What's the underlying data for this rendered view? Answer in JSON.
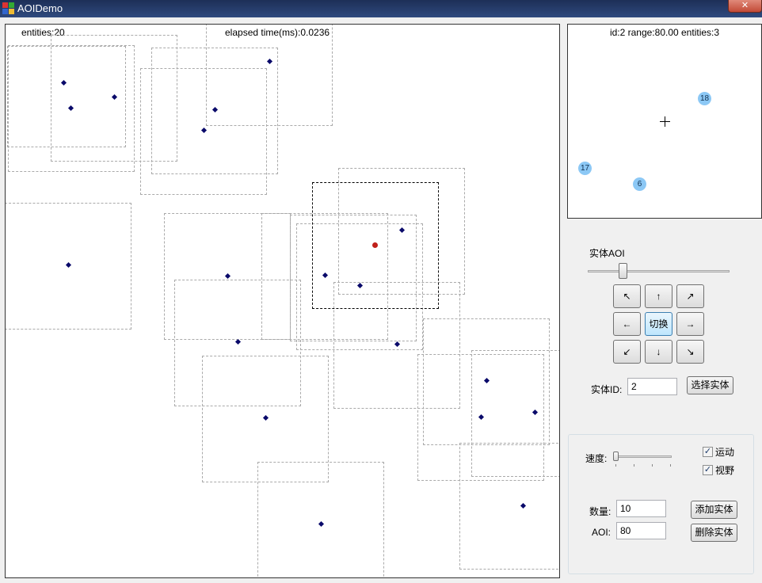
{
  "window": {
    "title": "AOIDemo",
    "close_glyph": "✕"
  },
  "world": {
    "entities_text": "entities:20",
    "elapsed_text": "elapsed time(ms):0.0236"
  },
  "minimap": {
    "info": "id:2 range:80.00 entities:3",
    "neighbors": [
      "18",
      "17",
      "6"
    ]
  },
  "controls": {
    "entity_aoi_label": "实体AOI",
    "directions": {
      "up_left": "↖",
      "up": "↑",
      "up_right": "↗",
      "left": "←",
      "toggle": "切换",
      "right": "→",
      "down_left": "↙",
      "down": "↓",
      "down_right": "↘"
    },
    "entity_id_label": "实体ID:",
    "entity_id_value": "2",
    "select_entity_button": "选择实体",
    "speed_label": "速度:",
    "move_checkbox": {
      "label": "运动",
      "checked": true
    },
    "view_checkbox": {
      "label": "视野",
      "checked": true
    },
    "count_label": "数量:",
    "count_value": "10",
    "aoi_label": "AOI:",
    "aoi_value": "80",
    "add_entity_button": "添加实体",
    "delete_entity_button": "删除实体"
  },
  "colors": {
    "entity": "#0a0a6a",
    "selected_entity": "#c0201a",
    "neighbor": "#8cc8f5",
    "aoi_box": "#aaaaaa"
  }
}
